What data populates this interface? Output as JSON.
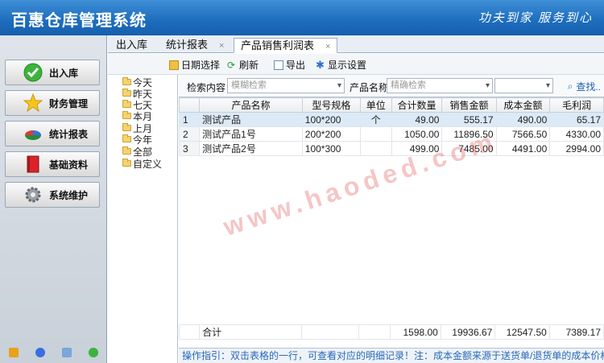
{
  "app": {
    "title": "百惠仓库管理系统",
    "slogan": "功夫到家 服务到心"
  },
  "sidebar": {
    "items": [
      {
        "label": "出入库",
        "icon": "check-circle-icon"
      },
      {
        "label": "财务管理",
        "icon": "star-icon"
      },
      {
        "label": "统计报表",
        "icon": "pie-chart-icon"
      },
      {
        "label": "基础资料",
        "icon": "book-icon"
      },
      {
        "label": "系统维护",
        "icon": "gear-icon"
      }
    ]
  },
  "tabs": [
    {
      "label": "出入库"
    },
    {
      "label": "统计报表"
    },
    {
      "label": "产品销售利润表"
    }
  ],
  "toolbar": {
    "date_select": "日期选择",
    "refresh": "刷新",
    "export": "导出",
    "display_settings": "显示设置"
  },
  "tree": [
    "今天",
    "昨天",
    "七天",
    "本月",
    "上月",
    "今年",
    "全部",
    "自定义"
  ],
  "search": {
    "content_label": "检索内容",
    "content_placeholder": "模糊检索",
    "product_label": "产品名称",
    "product_placeholder": "精确检索",
    "search_button": "查找.."
  },
  "table": {
    "headers": [
      "产品名称",
      "型号规格",
      "单位",
      "合计数量",
      "销售金额",
      "成本金额",
      "毛利润"
    ],
    "rows": [
      {
        "idx": "1",
        "name": "测试产品",
        "spec": "100*200",
        "unit": "个",
        "qty": "49.00",
        "sales": "555.17",
        "cost": "490.00",
        "profit": "65.17"
      },
      {
        "idx": "2",
        "name": "测试产品1号",
        "spec": "200*200",
        "unit": "",
        "qty": "1050.00",
        "sales": "11896.50",
        "cost": "7566.50",
        "profit": "4330.00"
      },
      {
        "idx": "3",
        "name": "测试产品2号",
        "spec": "100*300",
        "unit": "",
        "qty": "499.00",
        "sales": "7485.00",
        "cost": "4491.00",
        "profit": "2994.00"
      }
    ],
    "total": {
      "label": "合计",
      "qty": "1598.00",
      "sales": "19936.67",
      "cost": "12547.50",
      "profit": "7389.17"
    }
  },
  "status": "操作指引：双击表格的一行，可查看对应的明细记录！注：成本金额来源于送货单/退货单的成本价格，在仅统计送货",
  "watermark": "www.haoded.com",
  "colors": {
    "header_blue": "#1f6fbf",
    "selected_row": "#dce9f7",
    "status_text": "#2869b8"
  }
}
